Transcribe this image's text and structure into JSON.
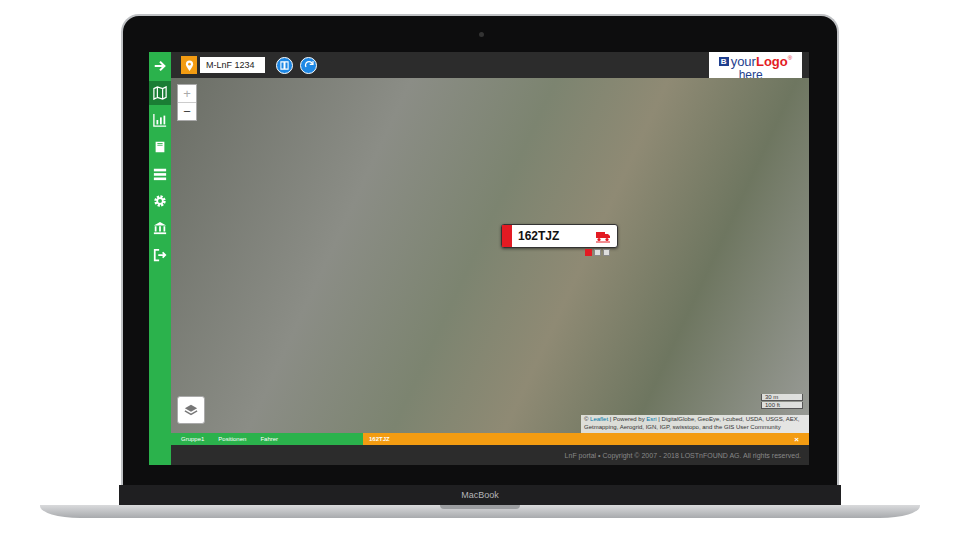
{
  "device": {
    "brand": "MacBook"
  },
  "toolbar": {
    "vehicle_field": {
      "value": "M-LnF 1234"
    }
  },
  "logo": {
    "prefix": "B",
    "word1": "your",
    "word2": "Logo",
    "mark": "®",
    "word3": "here"
  },
  "sidebar": {
    "items": [
      {
        "kind": "arrow",
        "selected": false
      },
      {
        "kind": "map",
        "selected": true
      },
      {
        "kind": "chart",
        "selected": false
      },
      {
        "kind": "book",
        "selected": false
      },
      {
        "kind": "list",
        "selected": false
      },
      {
        "kind": "gear",
        "selected": false
      },
      {
        "kind": "bank",
        "selected": false
      },
      {
        "kind": "logout",
        "selected": false
      }
    ]
  },
  "map": {
    "zoom_in": "+",
    "zoom_out": "−",
    "marker": {
      "label": "162TJZ",
      "pages": [
        {
          "selected": true
        },
        {
          "selected": false
        },
        {
          "selected": false
        }
      ]
    },
    "scale": [
      "30 m",
      "100 ft"
    ],
    "attribution": [
      {
        "text": "© ",
        "link": false
      },
      {
        "text": "Leaflet",
        "link": true
      },
      {
        "text": " | Powered by ",
        "link": false
      },
      {
        "text": "Esri",
        "link": true
      },
      {
        "text": " | DigitalGlobe, GeoEye, i-cubed, USDA, USGS, AEX, Getmapping, Aerogrid, IGN, IGP, swisstopo, and the GIS User Community",
        "link": false
      }
    ]
  },
  "bottom_panel": {
    "tabs": [
      {
        "label": "Gruppe1",
        "selected": false
      },
      {
        "label": "Positionen",
        "selected": false
      },
      {
        "label": "Fahrer",
        "selected": false
      }
    ],
    "title": "162TJZ",
    "close": "×"
  },
  "footer": {
    "text": "LnF portal • Copyright © 2007 - 2018 LOSTnFOUND AG. All rights reserved."
  }
}
